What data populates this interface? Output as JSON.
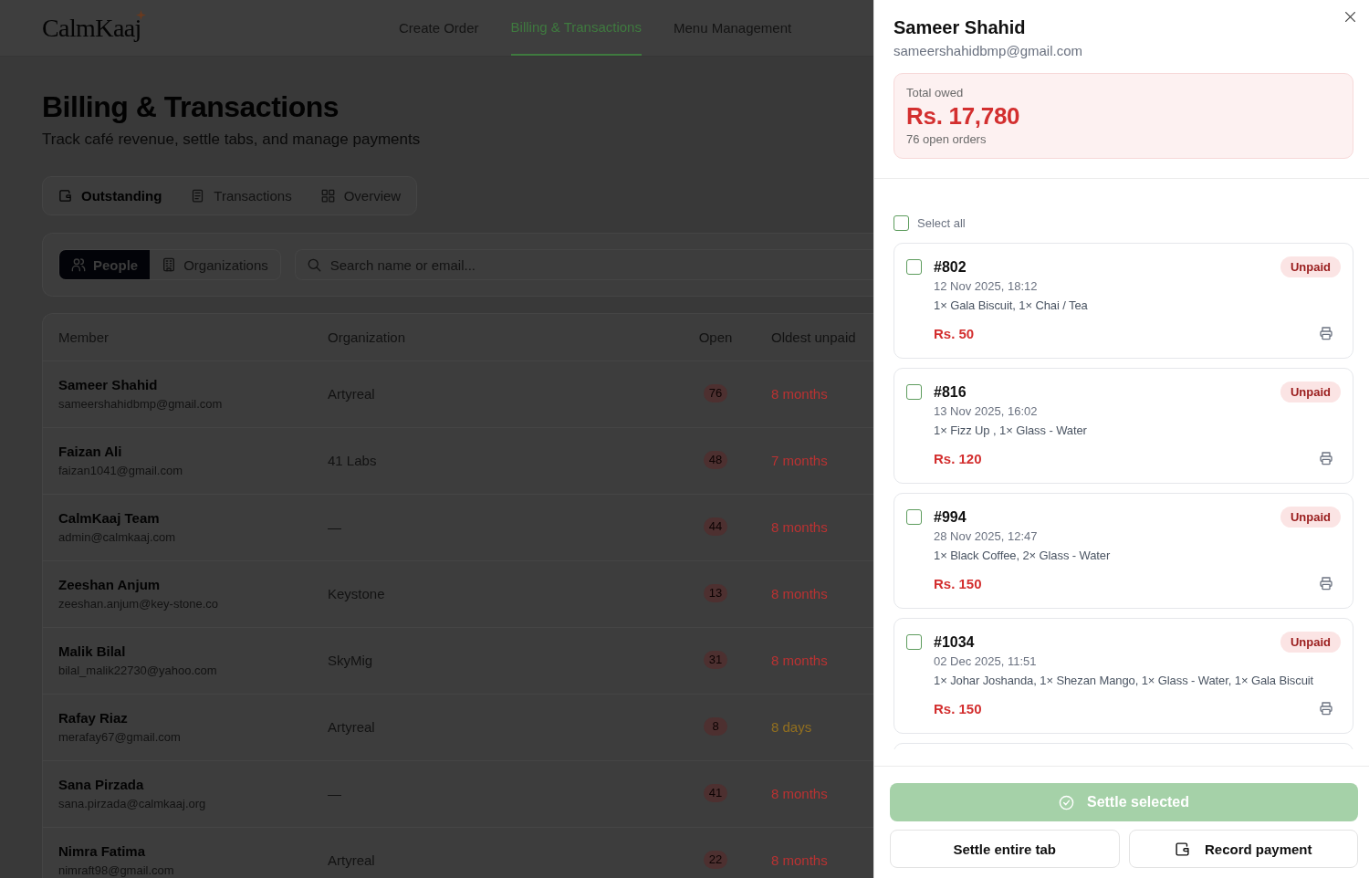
{
  "header": {
    "logo": "CalmKaaj",
    "nav": [
      {
        "label": "Create Order",
        "selected": false
      },
      {
        "label": "Billing & Transactions",
        "selected": true
      },
      {
        "label": "Menu Management",
        "selected": false
      }
    ]
  },
  "page": {
    "title": "Billing & Transactions",
    "subtitle": "Track café revenue, settle tabs, and manage payments"
  },
  "view_tabs": [
    {
      "label": "Outstanding",
      "selected": true
    },
    {
      "label": "Transactions",
      "selected": false
    },
    {
      "label": "Overview",
      "selected": false
    }
  ],
  "filter": {
    "toggle": [
      {
        "label": "People",
        "selected": true
      },
      {
        "label": "Organizations",
        "selected": false
      }
    ],
    "search": {
      "placeholder": "Search name or email..."
    }
  },
  "table": {
    "columns": [
      "Member",
      "Organization",
      "Open",
      "Oldest unpaid"
    ],
    "rows": [
      {
        "name": "Sameer Shahid",
        "email": "sameershahidbmp@gmail.com",
        "organization": "Artyreal",
        "open": "76",
        "oldest_unpaid": "8 months",
        "color": "#bb3232"
      },
      {
        "name": "Faizan Ali",
        "email": "faizan1041@gmail.com",
        "organization": "41 Labs",
        "open": "48",
        "oldest_unpaid": "7 months",
        "color": "#bb3232"
      },
      {
        "name": "CalmKaaj Team",
        "email": "admin@calmkaaj.com",
        "organization": "—",
        "open": "44",
        "oldest_unpaid": "8 months",
        "color": "#bb3232"
      },
      {
        "name": "Zeeshan Anjum",
        "email": "zeeshan.anjum@key-stone.co",
        "organization": "Keystone",
        "open": "13",
        "oldest_unpaid": "8 months",
        "color": "#bb3232"
      },
      {
        "name": "Malik Bilal",
        "email": "bilal_malik22730@yahoo.com",
        "organization": "SkyMig",
        "open": "31",
        "oldest_unpaid": "8 months",
        "color": "#bb3232"
      },
      {
        "name": "Rafay Riaz",
        "email": "merafay67@gmail.com",
        "organization": "Artyreal",
        "open": "8",
        "oldest_unpaid": "8 days",
        "color": "#93701f"
      },
      {
        "name": "Sana Pirzada",
        "email": "sana.pirzada@calmkaaj.org",
        "organization": "—",
        "open": "41",
        "oldest_unpaid": "8 months",
        "color": "#bb3232"
      },
      {
        "name": "Nimra Fatima",
        "email": "nimraft98@gmail.com",
        "organization": "Artyreal",
        "open": "22",
        "oldest_unpaid": "8 months",
        "color": "#bb3232"
      }
    ]
  },
  "drawer": {
    "name": "Sameer Shahid",
    "email": "sameershahidbmp@gmail.com",
    "summary": {
      "label": "Total owed",
      "amount": "Rs. 17,780",
      "note": "76 open orders"
    },
    "select_all": {
      "label": "Select all",
      "checked": false
    },
    "orders": [
      {
        "number": "#802",
        "status": "Unpaid",
        "date": "12 Nov 2025, 18:12",
        "items": "1× Gala Biscuit, 1× Chai / Tea",
        "amount": "Rs. 50",
        "checked": false
      },
      {
        "number": "#816",
        "status": "Unpaid",
        "date": "13 Nov 2025, 16:02",
        "items": "1× Fizz Up , 1× Glass - Water",
        "amount": "Rs. 120",
        "checked": false
      },
      {
        "number": "#994",
        "status": "Unpaid",
        "date": "28 Nov 2025, 12:47",
        "items": "1× Black Coffee, 2× Glass - Water",
        "amount": "Rs. 150",
        "checked": false
      },
      {
        "number": "#1034",
        "status": "Unpaid",
        "date": "02 Dec 2025, 11:51",
        "items": "1× Johar Joshanda, 1× Shezan Mango, 1× Glass - Water, 1× Gala Biscuit",
        "amount": "Rs. 150",
        "checked": false
      }
    ],
    "actions": {
      "settle_selected": {
        "label": "Settle selected",
        "disabled": true
      },
      "secondary": [
        {
          "label": "Settle entire tab",
          "kind": "plain"
        },
        {
          "label": "Record payment",
          "kind": "payment"
        }
      ]
    }
  }
}
